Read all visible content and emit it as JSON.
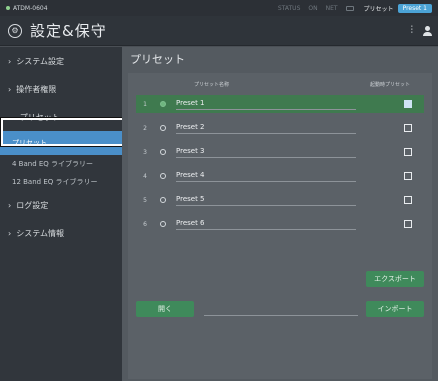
{
  "topbar": {
    "device": "ATDM-0604",
    "status_items": [
      "STATUS",
      "ON",
      "NET"
    ],
    "preset_label": "プリセット",
    "preset_badge": "Preset 1"
  },
  "header": {
    "title_icon": "gear-icon",
    "title": "設定&保守",
    "right_icons": [
      "signal-icon",
      "user-icon"
    ]
  },
  "sidebar": {
    "items": [
      {
        "label": "システム設定",
        "chevron": ">"
      },
      {
        "label": "操作者権限",
        "chevron": ">"
      },
      {
        "label": "プリセット",
        "chevron": "v"
      },
      {
        "label": "プリセット",
        "sub": true,
        "active": true
      },
      {
        "label": "4 Band EQ ライブラリー",
        "sub": true
      },
      {
        "label": "12 Band EQ ライブラリー",
        "sub": true
      },
      {
        "label": "ログ設定",
        "chevron": ">"
      },
      {
        "label": "システム情報",
        "chevron": ">"
      }
    ]
  },
  "main": {
    "title": "プリセット",
    "col_name": "プリセット名称",
    "col_startup": "起動時プリセット",
    "presets": [
      {
        "num": "1",
        "name": "Preset 1",
        "selected": true,
        "startup": true
      },
      {
        "num": "2",
        "name": "Preset 2",
        "selected": false,
        "startup": false
      },
      {
        "num": "3",
        "name": "Preset 3",
        "selected": false,
        "startup": false
      },
      {
        "num": "4",
        "name": "Preset 4",
        "selected": false,
        "startup": false
      },
      {
        "num": "5",
        "name": "Preset 5",
        "selected": false,
        "startup": false
      },
      {
        "num": "6",
        "name": "Preset 6",
        "selected": false,
        "startup": false
      }
    ],
    "export_label": "エクスポート",
    "open_label": "開く",
    "import_label": "インポート"
  }
}
